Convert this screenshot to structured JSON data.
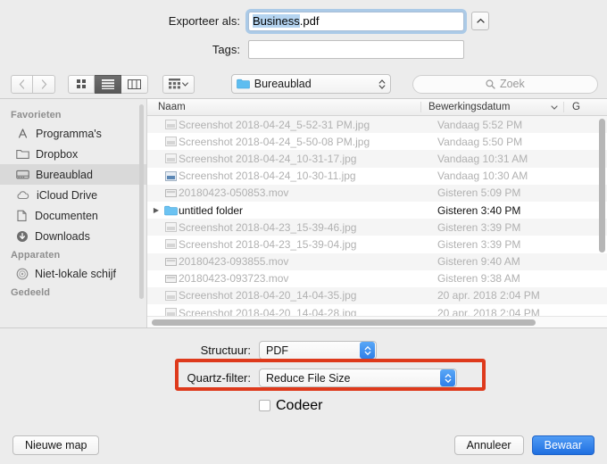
{
  "save_panel": {
    "export_label": "Exporteer als:",
    "filename_selected": "Business",
    "filename_extension": ".pdf",
    "tags_label": "Tags:",
    "tags_value": "",
    "expand_icon": "chevron-up-icon"
  },
  "toolbar": {
    "back_icon": "chevron-left-icon",
    "forward_icon": "chevron-right-icon",
    "view_icon_grid": "grid-view-icon",
    "view_list": "list-view-icon",
    "view_columns": "column-view-icon",
    "arrange_icon": "arrange-by-icon",
    "arrange_chevron": "chevron-down-icon",
    "path_folder_icon": "folder-icon",
    "path_value": "Bureaublad",
    "path_chevrons_icon": "up-down-chevron-icon",
    "search_icon": "search-icon",
    "search_placeholder": "Zoek"
  },
  "sidebar": {
    "sections": [
      {
        "title": "Favorieten",
        "items": [
          {
            "label": "Programma's",
            "icon": "applications-icon",
            "selected": false
          },
          {
            "label": "Dropbox",
            "icon": "folder-outline-icon",
            "selected": false
          },
          {
            "label": "Bureaublad",
            "icon": "desktop-icon",
            "selected": true
          },
          {
            "label": "iCloud Drive",
            "icon": "cloud-icon",
            "selected": false
          },
          {
            "label": "Documenten",
            "icon": "documents-icon",
            "selected": false
          },
          {
            "label": "Downloads",
            "icon": "download-circle-icon",
            "selected": false
          }
        ]
      },
      {
        "title": "Apparaten",
        "items": [
          {
            "label": "Niet-lokale schijf",
            "icon": "disc-icon",
            "selected": false
          }
        ]
      },
      {
        "title": "Gedeeld",
        "items": []
      }
    ]
  },
  "file_list": {
    "columns": [
      "Naam",
      "Bewerkingsdatum",
      "G"
    ],
    "sort_chevron_icon": "chevron-down-icon",
    "rows": [
      {
        "name": "Screenshot 2018-04-24_5-52-31 PM.jpg",
        "date": "Vandaag 5:52 PM",
        "icon": "image-file-icon",
        "enabled": false,
        "folder": false
      },
      {
        "name": "Screenshot 2018-04-24_5-50-08 PM.jpg",
        "date": "Vandaag 5:50 PM",
        "icon": "image-file-icon",
        "enabled": false,
        "folder": false
      },
      {
        "name": "Screenshot 2018-04-24_10-31-17.jpg",
        "date": "Vandaag 10:31 AM",
        "icon": "image-file-icon",
        "enabled": false,
        "folder": false
      },
      {
        "name": "Screenshot 2018-04-24_10-30-11.jpg",
        "date": "Vandaag 10:30 AM",
        "icon": "image-file-icon",
        "enabled": false,
        "folder": false
      },
      {
        "name": "20180423-050853.mov",
        "date": "Gisteren 5:09 PM",
        "icon": "movie-file-icon",
        "enabled": false,
        "folder": false
      },
      {
        "name": "untitled folder",
        "date": "Gisteren 3:40 PM",
        "icon": "folder-icon",
        "enabled": true,
        "folder": true
      },
      {
        "name": "Screenshot 2018-04-23_15-39-46.jpg",
        "date": "Gisteren 3:39 PM",
        "icon": "image-file-icon",
        "enabled": false,
        "folder": false
      },
      {
        "name": "Screenshot 2018-04-23_15-39-04.jpg",
        "date": "Gisteren 3:39 PM",
        "icon": "image-file-icon",
        "enabled": false,
        "folder": false
      },
      {
        "name": "20180423-093855.mov",
        "date": "Gisteren 9:40 AM",
        "icon": "movie-file-icon",
        "enabled": false,
        "folder": false
      },
      {
        "name": "20180423-093723.mov",
        "date": "Gisteren 9:38 AM",
        "icon": "movie-file-icon",
        "enabled": false,
        "folder": false
      },
      {
        "name": "Screenshot 2018-04-20_14-04-35.jpg",
        "date": "20 apr. 2018 2:04 PM",
        "icon": "image-file-icon",
        "enabled": false,
        "folder": false
      },
      {
        "name": "Screenshot 2018-04-20_14-04-28.jpg",
        "date": "20 apr. 2018 2:04 PM",
        "icon": "image-file-icon",
        "enabled": false,
        "folder": false
      }
    ]
  },
  "options": {
    "structuur_label": "Structuur:",
    "structuur_value": "PDF",
    "quartz_label": "Quartz-filter:",
    "quartz_value": "Reduce File Size",
    "codeer_label": "Codeer",
    "codeer_checked": false,
    "highlight_color": "#de3a1c"
  },
  "footer": {
    "new_folder_label": "Nieuwe map",
    "cancel_label": "Annuleer",
    "save_label": "Bewaar"
  }
}
